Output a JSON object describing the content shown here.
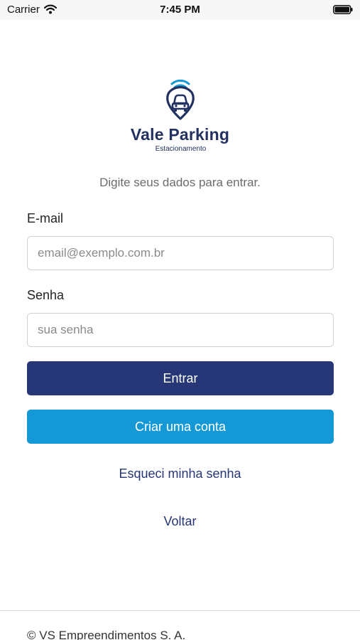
{
  "status_bar": {
    "carrier": "Carrier",
    "time": "7:45 PM"
  },
  "logo": {
    "title": "Vale Parking",
    "subtitle": "Estacionamento",
    "icon": "car-pin-wifi-icon",
    "colors": {
      "primary": "#22315f",
      "accent": "#1599d6"
    }
  },
  "prompt": "Digite seus dados para entrar.",
  "form": {
    "email_label": "E-mail",
    "email_placeholder": "email@exemplo.com.br",
    "password_label": "Senha",
    "password_placeholder": "sua senha",
    "login_button": "Entrar",
    "create_account_button": "Criar uma conta",
    "forgot_password_link": "Esqueci minha senha",
    "back_link": "Voltar"
  },
  "colors": {
    "login_button": "#263677",
    "create_button": "#1599d6",
    "link": "#263677"
  },
  "footer": {
    "text": "© VS Empreendimentos S. A."
  }
}
